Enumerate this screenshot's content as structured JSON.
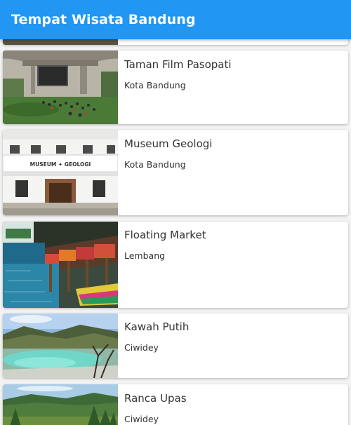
{
  "app_bar": {
    "title": "Tempat Wisata Bandung",
    "color": "#2196f3"
  },
  "places": [
    {
      "name": "Taman Film Pasopati",
      "location": "Kota Bandung",
      "image": "park-under-bridge-photo"
    },
    {
      "name": "Museum Geologi",
      "location": "Kota Bandung",
      "image": "museum-building-photo",
      "sign": "MUSEUM ✦ GEOLOGI"
    },
    {
      "name": "Floating Market",
      "location": "Lembang",
      "image": "floating-market-photo"
    },
    {
      "name": "Kawah Putih",
      "location": "Ciwidey",
      "image": "crater-lake-photo"
    },
    {
      "name": "Ranca Upas",
      "location": "Ciwidey",
      "image": "forest-meadow-photo"
    }
  ]
}
